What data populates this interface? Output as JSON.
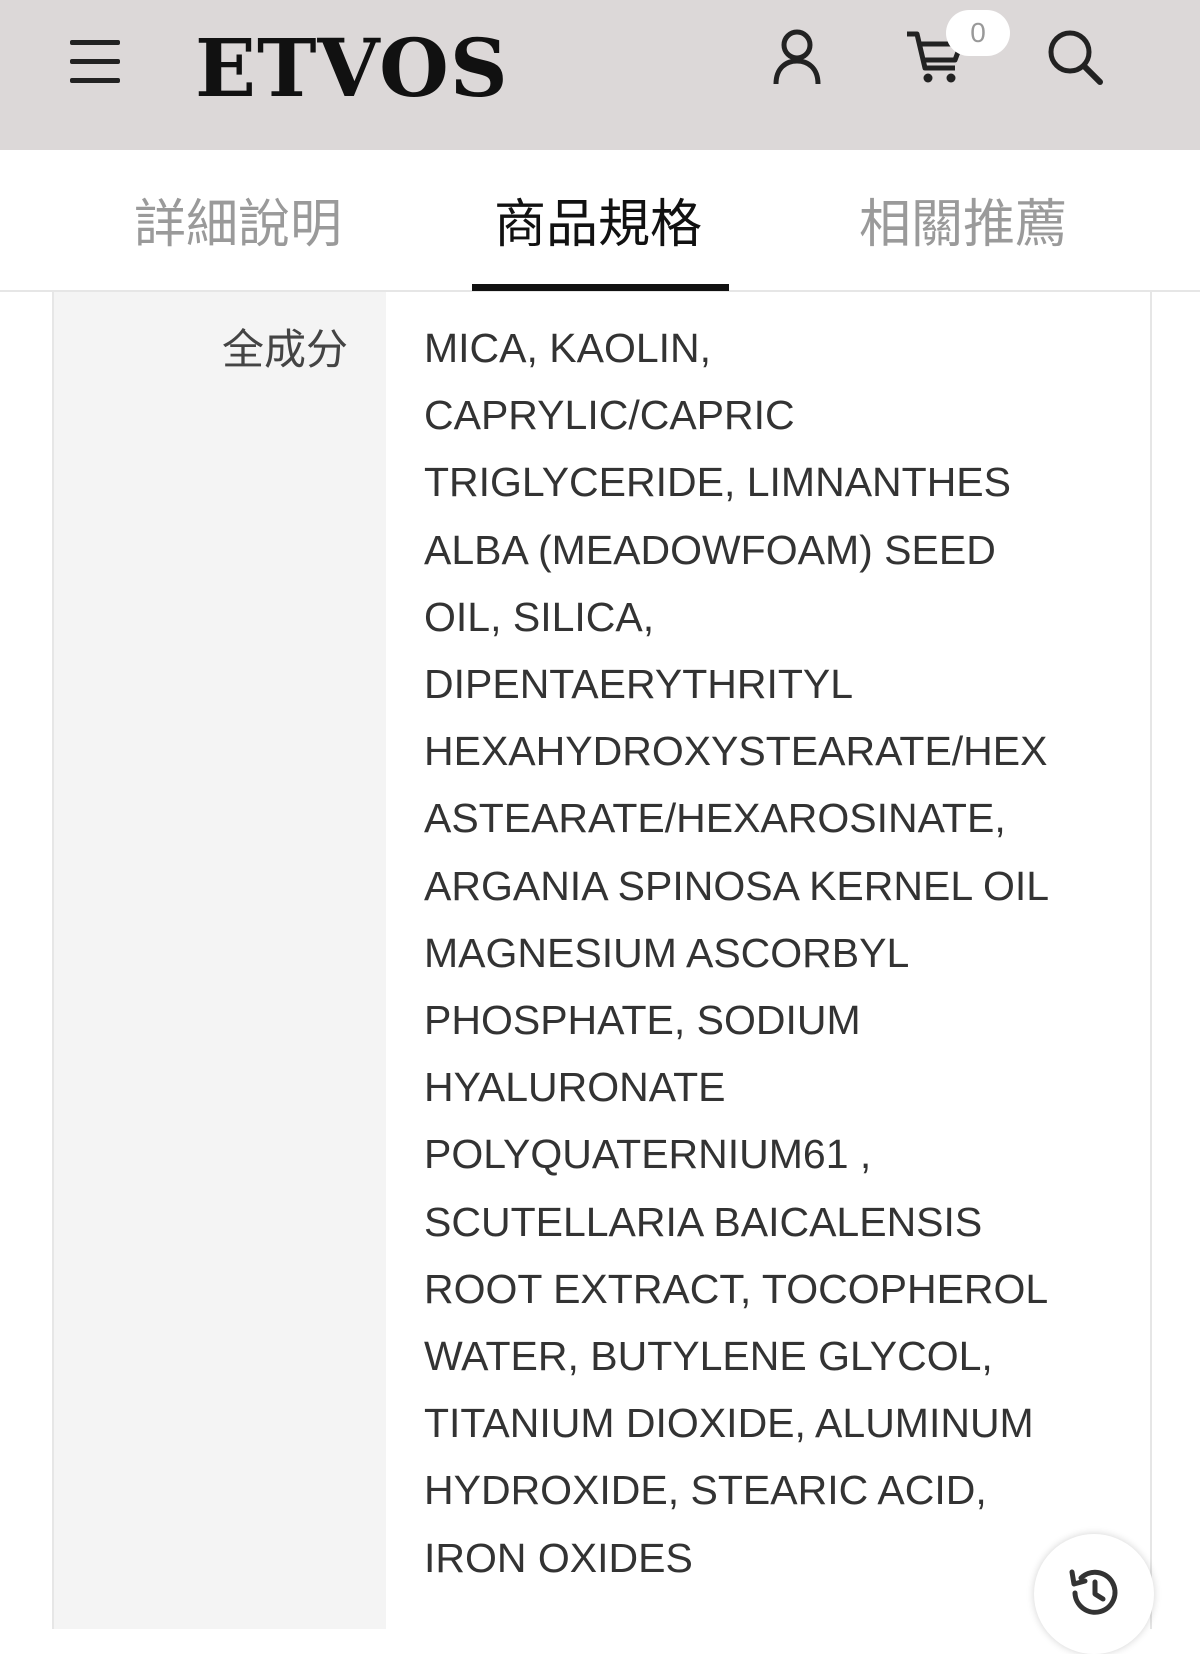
{
  "header": {
    "logo": "ETVOS",
    "cart_count": "0",
    "icons": [
      "menu-icon",
      "user-icon",
      "cart-icon",
      "search-icon"
    ]
  },
  "tabs": [
    {
      "label": "詳細說明",
      "active": false
    },
    {
      "label": "商品規格",
      "active": true
    },
    {
      "label": "相關推薦",
      "active": false
    }
  ],
  "spec": {
    "label": "全成分",
    "lines": [
      "MICA, KAOLIN,",
      "CAPRYLIC/CAPRIC",
      "TRIGLYCERIDE, LIMNANTHES",
      "ALBA (MEADOWFOAM) SEED",
      "OIL, SILICA,",
      "DIPENTAERYTHRITYL",
      "HEXAHYDROXYSTEARATE/HEX",
      "ASTEARATE/HEXAROSINATE,",
      "ARGANIA SPINOSA KERNEL OIL",
      "MAGNESIUM ASCORBYL",
      "PHOSPHATE, SODIUM",
      "HYALURONATE",
      "POLYQUATERNIUM61 ,",
      "SCUTELLARIA BAICALENSIS",
      "ROOT EXTRACT, TOCOPHEROL",
      "WATER, BUTYLENE GLYCOL,",
      "TITANIUM DIOXIDE, ALUMINUM",
      "HYDROXIDE, STEARIC ACID,",
      "IRON OXIDES"
    ]
  },
  "floating": {
    "icon": "history-icon"
  }
}
